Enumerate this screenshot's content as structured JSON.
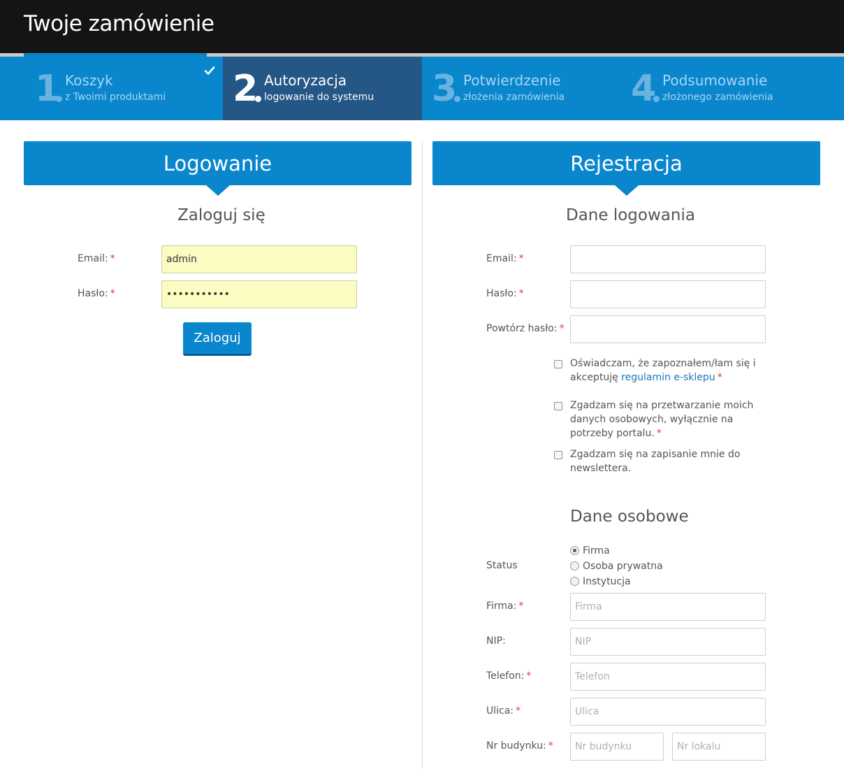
{
  "header": {
    "title": "Twoje zamówienie"
  },
  "steps": [
    {
      "number": "1",
      "label": "Koszyk",
      "sub": "z Twoimi produktami",
      "done": true
    },
    {
      "number": "2",
      "label": "Autoryzacja",
      "sub": "logowanie do systemu",
      "active": true
    },
    {
      "number": "3",
      "label": "Potwierdzenie",
      "sub": "złożenia zamówienia"
    },
    {
      "number": "4",
      "label": "Podsumowanie",
      "sub": "złożonego zamówienia"
    }
  ],
  "login": {
    "title": "Logowanie",
    "subtitle": "Zaloguj się",
    "email_label": "Email:",
    "email_value": "admin",
    "password_label": "Hasło:",
    "password_value": "•••••••••••",
    "submit_label": "Zaloguj",
    "required_mark": "*"
  },
  "register": {
    "title": "Rejestracja",
    "login_section": "Dane logowania",
    "email_label": "Email:",
    "password_label": "Hasło:",
    "repeat_password_label": "Powtórz hasło:",
    "required_mark": "*",
    "terms_text": "Oświadczam, że zapoznałem/łam się i akceptuję",
    "terms_link": "regulamin e-sklepu",
    "privacy_text": "Zgadzam się na przetwarzanie moich danych osobowych, wyłącznie na potrzeby portalu.",
    "newsletter_text": "Zgadzam się na zapisanie mnie do newslettera.",
    "personal_section": "Dane osobowe",
    "status_label": "Status",
    "status_options": [
      "Firma",
      "Osoba prywatna",
      "Instytucja"
    ],
    "status_selected": "Firma",
    "company_label": "Firma:",
    "company_placeholder": "Firma",
    "nip_label": "NIP:",
    "nip_placeholder": "NIP",
    "phone_label": "Telefon:",
    "phone_placeholder": "Telefon",
    "street_label": "Ulica:",
    "street_placeholder": "Ulica",
    "building_label": "Nr budynku:",
    "building_placeholder": "Nr budynku",
    "apartment_placeholder": "Nr lokalu"
  },
  "colors": {
    "brand_blue": "#0a86cd",
    "active_step": "#245786",
    "topbar": "#141414",
    "required": "#e0393e"
  }
}
